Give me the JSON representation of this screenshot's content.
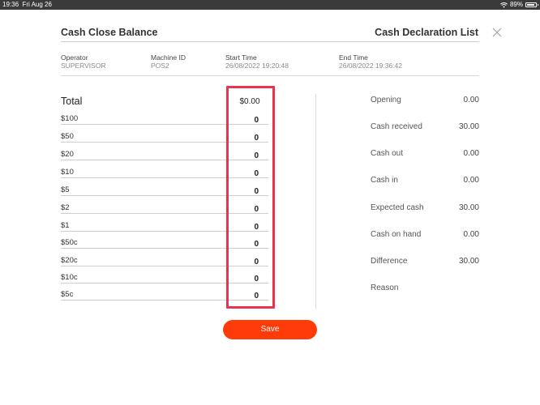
{
  "status_bar": {
    "time": "19:36",
    "date": "Fri Aug 26",
    "battery": "89%"
  },
  "header": {
    "title_left": "Cash Close Balance",
    "title_right": "Cash Declaration List",
    "close_icon": "close-icon"
  },
  "info": {
    "operator_label": "Operator",
    "operator_value": "SUPERVISOR",
    "machine_label": "Machine ID",
    "machine_value": "POS2",
    "start_label": "Start Time",
    "start_value": "26/08/2022 19:20:48",
    "end_label": "End Time",
    "end_value": "26/08/2022 19:36:42"
  },
  "total": {
    "label": "Total",
    "value": "$0.00"
  },
  "denominations": [
    {
      "label": "$100",
      "value": "0"
    },
    {
      "label": "$50",
      "value": "0"
    },
    {
      "label": "$20",
      "value": "0"
    },
    {
      "label": "$10",
      "value": "0"
    },
    {
      "label": "$5",
      "value": "0"
    },
    {
      "label": "$2",
      "value": "0"
    },
    {
      "label": "$1",
      "value": "0"
    },
    {
      "label": "$50c",
      "value": "0"
    },
    {
      "label": "$20c",
      "value": "0"
    },
    {
      "label": "$10c",
      "value": "0"
    },
    {
      "label": "$5c",
      "value": "0"
    }
  ],
  "summary": [
    {
      "label": "Opening",
      "value": "0.00"
    },
    {
      "label": "Cash received",
      "value": "30.00"
    },
    {
      "label": "Cash out",
      "value": "0.00"
    },
    {
      "label": "Cash in",
      "value": "0.00"
    },
    {
      "label": "Expected cash",
      "value": "30.00"
    },
    {
      "label": "Cash on hand",
      "value": "0.00"
    },
    {
      "label": "Difference",
      "value": "30.00"
    },
    {
      "label": "Reason",
      "value": ""
    }
  ],
  "save_label": "Save",
  "colors": {
    "accent": "#ff3b0a",
    "highlight": "#e8344f"
  }
}
